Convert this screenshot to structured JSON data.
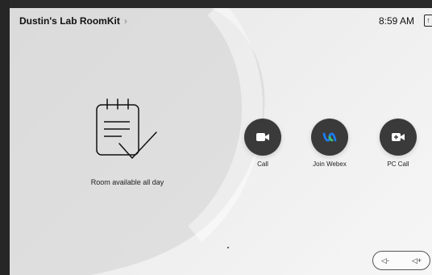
{
  "header": {
    "title": "Dustin's Lab RoomKit",
    "chevron": "›",
    "time": "8:59 AM",
    "status_icon_glyph": "↑"
  },
  "room_status": {
    "text": "Room available all day",
    "icon": "calendar-check-icon"
  },
  "actions": [
    {
      "label": "Call",
      "icon": "video-camera-icon"
    },
    {
      "label": "Join Webex",
      "icon": "webex-logo-icon"
    },
    {
      "label": "PC Call",
      "icon": "video-add-icon"
    }
  ],
  "volume": {
    "down_label": "◁-",
    "up_label": "◁+"
  },
  "colors": {
    "button_bg": "#3a3a3a",
    "webex_blue": "#1d7cf2",
    "webex_green": "#3ec46d"
  }
}
